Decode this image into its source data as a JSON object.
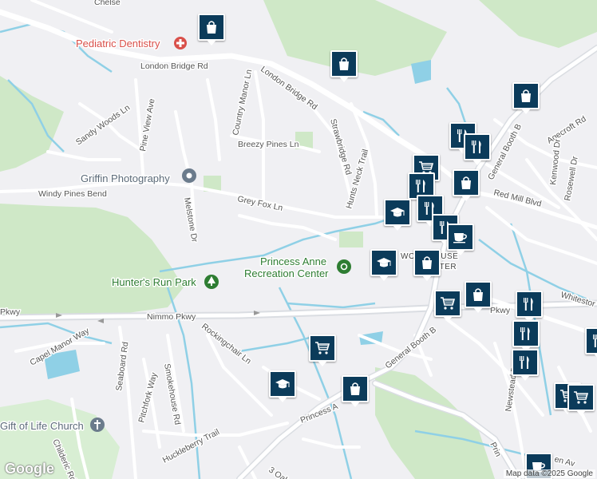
{
  "colors": {
    "background": "#f0f0f3",
    "park": "#cfe8c7",
    "water": "#8fd0e6",
    "road": "#ffffff",
    "highway": "#dadde2",
    "marker": "#0b3b5a",
    "hospital_red": "#d9504a",
    "place_label": "#2c6f8f",
    "park_label": "#2e7d32"
  },
  "roads": {
    "london_bridge_rd_a": "London Bridge Rd",
    "london_bridge_rd_b": "London Bridge Rd",
    "sandy_woods_ln": "Sandy Woods Ln",
    "pine_view_ave": "Pine View Ave",
    "country_manor_ln": "Country Manor Ln",
    "breezy_pines_ln": "Breezy Pines Ln",
    "strawbridge_rd": "Strawbridge Rd",
    "hunts_neck_trail": "Hunts Neck Trail",
    "windy_pines_bend": "Windy Pines Bend",
    "melstone_dr": "Melstone Dr",
    "grey_fox_ln": "Grey Fox Ln",
    "nimmo_pkwy": "Nimmo Pkwy",
    "pkwy_left": "Pkwy",
    "pkwy_right": "Pkwy",
    "capel_manor_way": "Capel Manor Way",
    "seaboard_rd": "Seaboard Rd",
    "rockingchair_ln": "Rockingchair Ln",
    "pitchfork_way": "Pitchfork Way",
    "smokehouse_rd": "Smokehouse Rd",
    "huckleberry_trail": "Huckleberry Trail",
    "childeric_rd": "Childeric Rd",
    "princess_anne": "Princess A",
    "general_booth_blvd_s": "General Booth B",
    "general_booth_blvd_n": "General Booth B",
    "red_mill_blvd": "Red Mill Blvd",
    "agecroft_rd": "Agecroft Rd",
    "kenwood_dr": "Kenwood Dr",
    "rosewell_dr": "Rosewell Dr",
    "whitestone": "Whitestor",
    "newstead_dr": "Newstead Dr",
    "princess_e": "Prin",
    "three_oak": "3 Oak",
    "chelsea": "Chelse",
    "woodhouse_center_a": "WOODHOUSE",
    "woodhouse_center_b": "CENTER",
    "bottom_right_road": "en Av"
  },
  "places": {
    "pediatric_dentistry": "Pediatric Dentistry",
    "griffin_photography": "Griffin Photography",
    "hunters_run_park": "Hunter's Run Park",
    "princess_anne_rec_1": "Princess Anne",
    "princess_anne_rec_2": "Recreation Center",
    "gift_of_life_church": "Gift of Life Church"
  },
  "markers": [
    {
      "icon": "shopping-bag-icon"
    },
    {
      "icon": "shopping-bag-icon"
    },
    {
      "icon": "shopping-bag-icon"
    },
    {
      "icon": "restaurant-icon"
    },
    {
      "icon": "restaurant-icon"
    },
    {
      "icon": "shopping-cart-icon"
    },
    {
      "icon": "restaurant-icon"
    },
    {
      "icon": "shopping-bag-icon"
    },
    {
      "icon": "school-icon"
    },
    {
      "icon": "restaurant-icon"
    },
    {
      "icon": "restaurant-icon"
    },
    {
      "icon": "coffee-icon"
    },
    {
      "icon": "school-icon"
    },
    {
      "icon": "shopping-bag-icon"
    },
    {
      "icon": "shopping-cart-icon"
    },
    {
      "icon": "shopping-bag-icon"
    },
    {
      "icon": "restaurant-icon"
    },
    {
      "icon": "restaurant-icon"
    },
    {
      "icon": "restaurant-icon"
    },
    {
      "icon": "shopping-cart-icon"
    },
    {
      "icon": "school-icon"
    },
    {
      "icon": "shopping-bag-icon"
    },
    {
      "icon": "shopping-cart-icon"
    },
    {
      "icon": "restaurant-icon"
    },
    {
      "icon": "shopping-cart-icon"
    },
    {
      "icon": "coffee-icon"
    }
  ],
  "footer": {
    "logo": "Google",
    "attribution": "Map data ©2025 Google"
  }
}
